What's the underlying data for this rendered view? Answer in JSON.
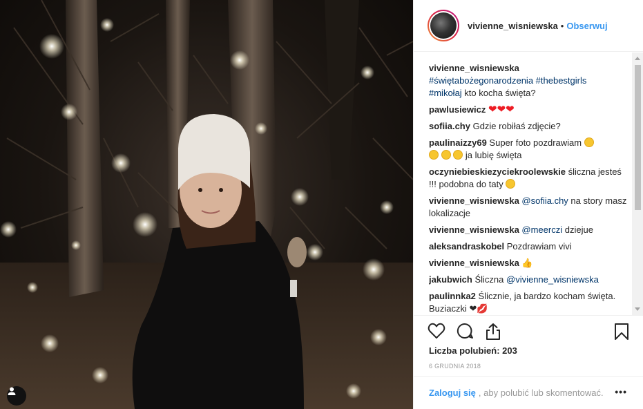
{
  "post": {
    "username": "vivienne_wisniewska",
    "follow_label": "Obserwuj",
    "separator": "•"
  },
  "caption": {
    "user": "vivienne_wisniewska",
    "hashtags_line1": "#świętabożegonarodzenia #thebestgirls",
    "hashtag_line2": "#mikołaj",
    "text": " kto kocha święta?"
  },
  "comments": [
    {
      "user": "pawlusiewicz",
      "text": " "
    },
    {
      "user": "sofiia.chy",
      "text": " Gdzie robiłaś zdjęcie?"
    },
    {
      "user": "paulinaizzy69",
      "text": " Super foto pozdrawiam ",
      "text2": " ja lubię święta"
    },
    {
      "user": "oczyniebieskiezyciekroolewskie",
      "text": " śliczna jesteś !!! podobna do taty "
    },
    {
      "user": "vivienne_wisniewska",
      "mention": " @sofiia.chy",
      "text": " na story masz lokalizacje"
    },
    {
      "user": "vivienne_wisniewska",
      "mention": " @meerczi",
      "text": " dziejue"
    },
    {
      "user": "aleksandraskobel",
      "text": " Pozdrawiam vivi"
    },
    {
      "user": "vivienne_wisniewska",
      "text": " 👍"
    },
    {
      "user": "jakubwich",
      "text": " Śliczna ",
      "mention": "@vivienne_wisniewska"
    },
    {
      "user": "paulinnka2",
      "text": " Ślicznie, ja bardzo kocham święta. Buziaczki ❤💋"
    }
  ],
  "hearts": "❤❤❤",
  "likes_label": "Liczba polubień: 203",
  "date": "6 GRUDNIA 2018",
  "login": {
    "link": "Zaloguj się",
    "text": ", aby polubić lub skomentować.",
    "more": "•••"
  },
  "icons": [
    "heart-icon",
    "comment-icon",
    "share-icon",
    "bookmark-icon",
    "user-tag-icon"
  ]
}
